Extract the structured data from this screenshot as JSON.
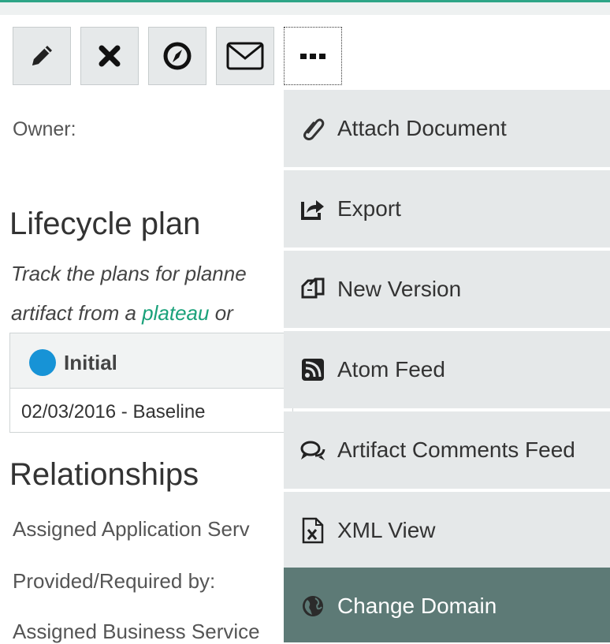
{
  "toolbar": {
    "buttons": [
      {
        "name": "edit",
        "icon": "pencil-icon"
      },
      {
        "name": "delete",
        "icon": "close-icon"
      },
      {
        "name": "navigate",
        "icon": "compass-icon"
      },
      {
        "name": "email",
        "icon": "envelope-icon"
      },
      {
        "name": "more",
        "icon": "ellipsis-icon"
      }
    ]
  },
  "details": {
    "owner_label": "Owner:"
  },
  "lifecycle": {
    "heading": "Lifecycle plan",
    "desc_line1": "Track the plans for planne",
    "desc_line2_pre": "artifact from a ",
    "desc_link": "plateau",
    "desc_line2_post": " or ",
    "stage": "Initial",
    "stage_color": "#1793d6",
    "row": "02/03/2016 - Baseline"
  },
  "relationships": {
    "heading": "Relationships",
    "items": [
      "Assigned Application Serv",
      "Provided/Required by:",
      "Assigned Business Service"
    ]
  },
  "menu": {
    "items": [
      {
        "label": "Attach Document",
        "icon": "paperclip-icon"
      },
      {
        "label": "Export",
        "icon": "export-icon"
      },
      {
        "label": "New Version",
        "icon": "new-version-icon"
      },
      {
        "label": "Atom Feed",
        "icon": "feed-icon"
      },
      {
        "label": "Artifact Comments Feed",
        "icon": "comments-icon"
      },
      {
        "label": "XML View",
        "icon": "xml-file-icon"
      },
      {
        "label": "Change Domain",
        "icon": "globe-icon"
      }
    ],
    "selected_index": 6
  },
  "colors": {
    "accent": "#2ea587",
    "link": "#1aa17a",
    "menu_bg": "#e5e8e9",
    "menu_selected": "#5d7a76"
  }
}
